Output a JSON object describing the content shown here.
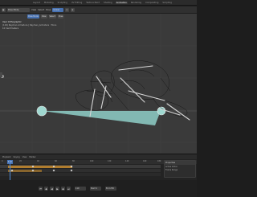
{
  "topbar": {
    "tabs": [
      "Layout",
      "Modeling",
      "Sculpting",
      "UV Editing",
      "Texture Paint",
      "Shading",
      "Animation",
      "Rendering",
      "Compositing",
      "Scripting"
    ],
    "active_tab": "Animation"
  },
  "header": {
    "mode": "Pose Mode",
    "menus": [
      "View",
      "Select",
      "Pose"
    ],
    "transform": "Global",
    "active_color": "#4772b3"
  },
  "viewport": {
    "buttons": [
      "Pose Mode",
      "View",
      "Select",
      "Pose"
    ],
    "info_line1": "User Orthographic",
    "info_line2": "(119) Rayman Armature | Rayman_Armature : Torso",
    "info_line3": "10 Centimeters",
    "background_color": "#3a3a3a",
    "floor_color": "#8fcfc8",
    "bone_color": "#cfcfcf"
  },
  "timeline": {
    "menus": [
      "Playback",
      "Keying",
      "View",
      "Marker"
    ],
    "ruler_labels": [
      "0",
      "20",
      "40",
      "60",
      "80",
      "100",
      "120",
      "140",
      "160",
      "180"
    ],
    "current_frame": "119",
    "bar_color": "#c58a2d"
  },
  "side_panel": {
    "title": "Properties",
    "row1": "Active Action",
    "row2": "Frame Range"
  },
  "controls": {
    "icons": [
      "jump-start-icon",
      "prev-keyframe-icon",
      "play-reverse-icon",
      "play-icon",
      "next-keyframe-icon",
      "jump-end-icon"
    ],
    "glyphs": [
      "⏮",
      "◆",
      "◀",
      "▶",
      "◆",
      "⏭"
    ],
    "frame": "119",
    "start": "Start 1",
    "end": "End 250"
  }
}
